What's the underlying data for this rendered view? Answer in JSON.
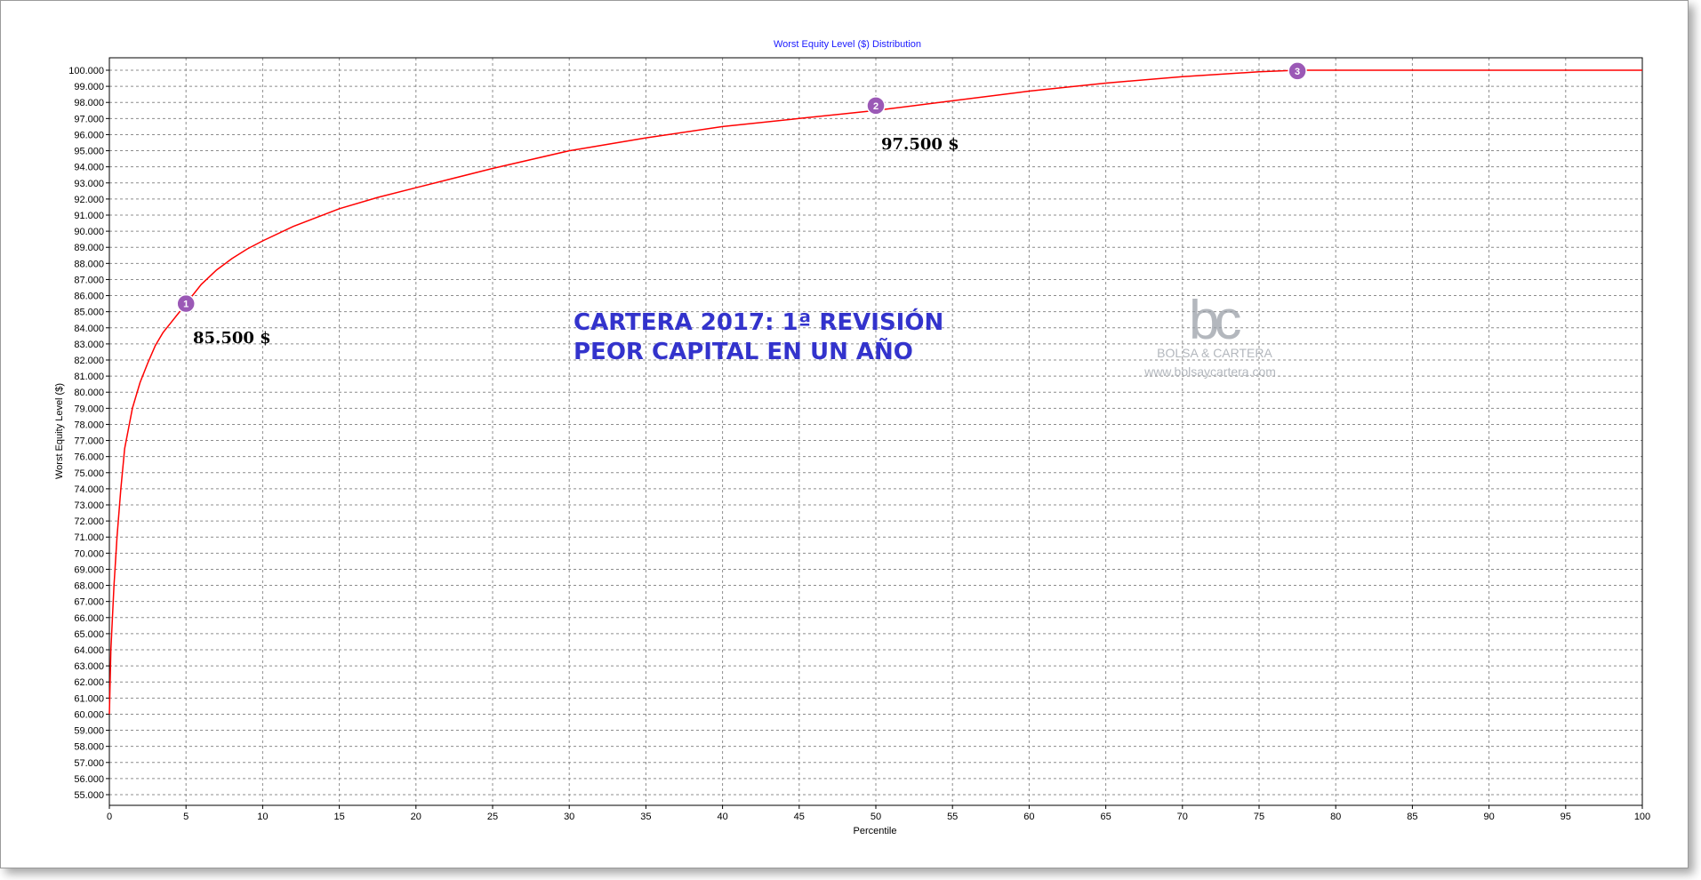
{
  "chart_data": {
    "type": "line",
    "title": "Worst Equity Level ($) Distribution",
    "xlabel": "Percentile",
    "ylabel": "Worst Equity Level ($)",
    "xlim": [
      0,
      100
    ],
    "ylim": [
      55000,
      100000
    ],
    "x_ticks": [
      0,
      5,
      10,
      15,
      20,
      25,
      30,
      35,
      40,
      45,
      50,
      55,
      60,
      65,
      70,
      75,
      80,
      85,
      90,
      95,
      100
    ],
    "y_ticks": [
      55000,
      56000,
      57000,
      58000,
      59000,
      60000,
      61000,
      62000,
      63000,
      64000,
      65000,
      66000,
      67000,
      68000,
      69000,
      70000,
      71000,
      72000,
      73000,
      74000,
      75000,
      76000,
      77000,
      78000,
      79000,
      80000,
      81000,
      82000,
      83000,
      84000,
      85000,
      86000,
      87000,
      88000,
      89000,
      90000,
      91000,
      92000,
      93000,
      94000,
      95000,
      96000,
      97000,
      98000,
      99000,
      100000
    ],
    "y_tick_labels": [
      "55.000",
      "56.000",
      "57.000",
      "58.000",
      "59.000",
      "60.000",
      "61.000",
      "62.000",
      "63.000",
      "64.000",
      "65.000",
      "66.000",
      "67.000",
      "68.000",
      "69.000",
      "70.000",
      "71.000",
      "72.000",
      "73.000",
      "74.000",
      "75.000",
      "76.000",
      "77.000",
      "78.000",
      "79.000",
      "80.000",
      "81.000",
      "82.000",
      "83.000",
      "84.000",
      "85.000",
      "86.000",
      "87.000",
      "88.000",
      "89.000",
      "90.000",
      "91.000",
      "92.000",
      "93.000",
      "94.000",
      "95.000",
      "96.000",
      "97.000",
      "98.000",
      "99.000",
      "100.000"
    ],
    "grid": true,
    "series": [
      {
        "color": "#ff0000",
        "x": [
          0,
          0.1,
          0.3,
          0.5,
          0.75,
          1,
          1.5,
          2,
          2.5,
          3,
          3.5,
          4,
          4.5,
          5,
          6,
          7,
          8,
          9,
          10,
          12,
          15,
          17.5,
          20,
          25,
          30,
          35,
          40,
          45,
          50,
          55,
          60,
          65,
          70,
          75,
          77.5,
          80,
          85,
          90,
          95,
          100
        ],
        "y": [
          60000,
          64000,
          68000,
          71000,
          74000,
          76500,
          79000,
          80600,
          81800,
          82900,
          83700,
          84300,
          84900,
          85500,
          86700,
          87600,
          88300,
          88900,
          89400,
          90300,
          91400,
          92100,
          92700,
          93900,
          95000,
          95800,
          96500,
          97000,
          97500,
          98100,
          98700,
          99200,
          99600,
          99900,
          100000,
          100000,
          100000,
          100000,
          100000,
          100000
        ]
      }
    ],
    "markers": [
      {
        "label": "1",
        "x": 5,
        "y": 85500
      },
      {
        "label": "2",
        "x": 50,
        "y": 97800
      },
      {
        "label": "3",
        "x": 77.5,
        "y": 99950
      }
    ],
    "annotations": {
      "value_1": "85.500 $",
      "value_2": "97.500 $",
      "title_line_1": "CARTERA 2017: 1ª REVISIÓN",
      "title_line_2": "PEOR CAPITAL EN UN AÑO"
    },
    "colors": {
      "line": "#ff0000",
      "marker": "#9b59b6",
      "title": "#1a1aff",
      "annotation_title": "#3333cc",
      "grid": "#8c8c8c"
    }
  },
  "watermark": {
    "logo_letters": "bc",
    "name": "BOLSA & CARTERA",
    "url": "www.bolsaycartera.com"
  }
}
